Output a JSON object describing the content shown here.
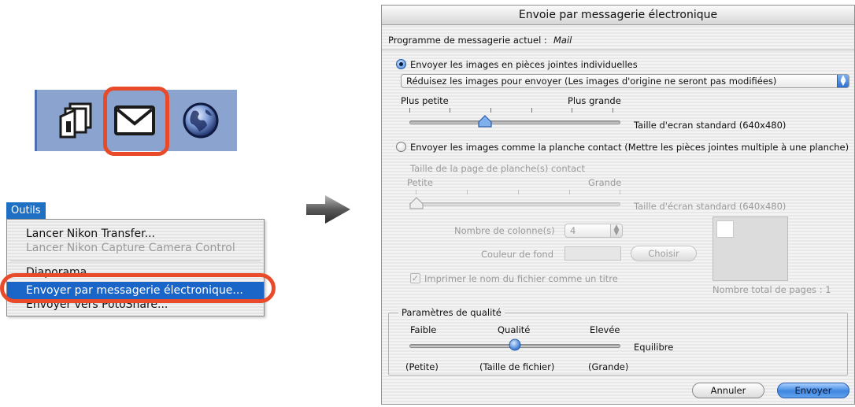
{
  "menu": {
    "title": "Outils",
    "items": [
      {
        "label": "Lancer Nikon Transfer...",
        "enabled": true
      },
      {
        "label": "Lancer Nikon Capture Camera Control",
        "enabled": false
      },
      {
        "label": "Diaporama",
        "enabled": true
      },
      {
        "label": "Envoyer par messagerie électronique...",
        "enabled": true,
        "selected": true
      },
      {
        "label": "Envoyer vers PotoShare...",
        "enabled": true
      }
    ]
  },
  "toolbar": {
    "icons": [
      "copy-icon",
      "mail-icon",
      "globe-icon"
    ],
    "highlighted": "mail-icon"
  },
  "dialog": {
    "title": "Envoie par messagerie électronique",
    "mail_program_label": "Programme de messagerie actuel :",
    "mail_program_value": "Mail",
    "option_individual": {
      "label": "Envoyer les images en pièces jointes individuelles",
      "selected": true,
      "popup_value": "Réduisez les images pour envoyer (Les images d'origine ne seront pas modifiées)",
      "slider_min_label": "Plus petite",
      "slider_max_label": "Plus grande",
      "slider_value_label": "Taille d'ecran standard (640x480)",
      "slider_fraction": 0.36
    },
    "option_contact": {
      "label": "Envoyer les images comme la planche contact (Mettre les pièces jointes multiple à une planche)",
      "selected": false,
      "size_title": "Taille de la page de planche(s) contact",
      "slider_min_label": "Petite",
      "slider_max_label": "Grande",
      "slider_value_label": "Taille d'écran standard (640x480)",
      "slider_fraction": 0.0,
      "columns_label": "Nombre de colonne(s)",
      "columns_value": "4",
      "bg_color_label": "Couleur de fond",
      "choose_button": "Choisir",
      "print_filename_label": "Imprimer le nom du fichier comme un titre",
      "print_filename_checked": true,
      "total_pages_label": "Nombre total de pages : 1"
    },
    "quality": {
      "group_title": "Paramètres de qualité",
      "low_label": "Faible",
      "mid_label": "Qualité",
      "high_label": "Elevée",
      "value_label": "Equilibre",
      "small_label": "(Petite)",
      "filesize_label": "(Taille de fichier)",
      "large_label": "(Grande)",
      "slider_fraction": 0.5
    },
    "cancel_button": "Annuler",
    "send_button": "Envoyer"
  },
  "colors": {
    "callout": "#e84a2a",
    "menu_selection": "#1a66c8",
    "toolbar_bg": "#8aa3cf",
    "default_button": "#3d86e0"
  }
}
